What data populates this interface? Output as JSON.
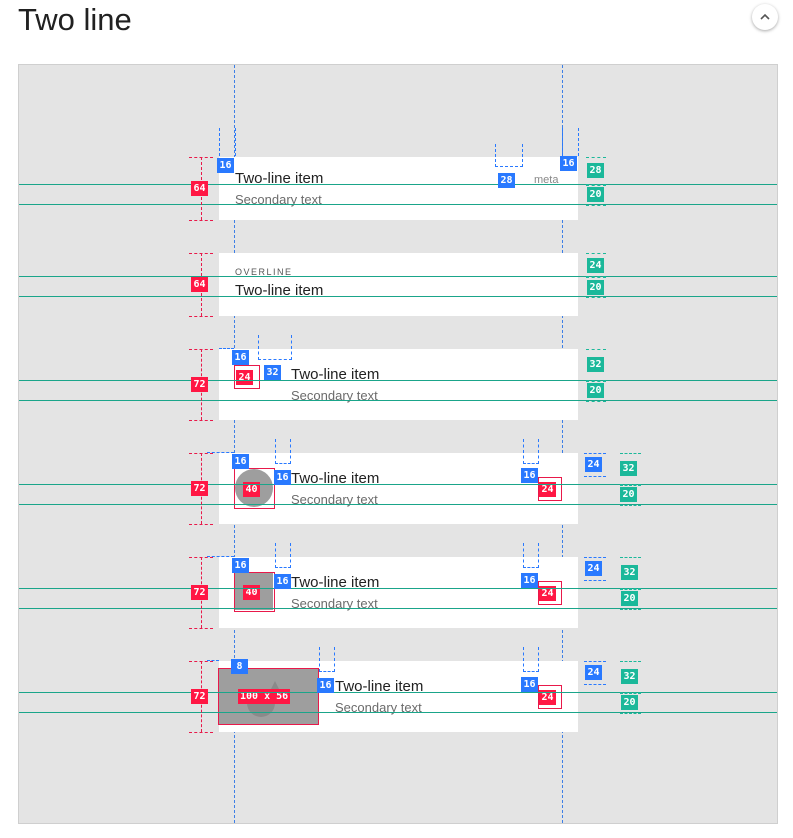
{
  "header": {
    "title": "Two line",
    "collapse_icon": "chevron-up-icon"
  },
  "colors": {
    "panel": "#e4e4e4",
    "keyline": "#1aa58a",
    "spacing": "#2979ff",
    "height": "#ff1744",
    "baseline": "#1bb89a"
  },
  "rows": [
    {
      "height": "64",
      "overline": "",
      "primary": "Two-line item",
      "secondary": "Secondary text",
      "meta": "meta",
      "leading": "",
      "trailing": "",
      "left_pad": "16",
      "text_gap": "",
      "trailing_gap": "",
      "right_pad": "16",
      "meta_gap": "28",
      "top_baseline": "28",
      "bottom_baseline": "20",
      "trailing_top": ""
    },
    {
      "height": "64",
      "overline": "OVERLINE",
      "primary": "Two-line item",
      "secondary": "",
      "meta": "",
      "leading": "",
      "trailing": "",
      "left_pad": "",
      "text_gap": "",
      "trailing_gap": "",
      "right_pad": "",
      "meta_gap": "",
      "top_baseline": "24",
      "bottom_baseline": "20",
      "trailing_top": ""
    },
    {
      "height": "72",
      "overline": "",
      "primary": "Two-line item",
      "secondary": "Secondary text",
      "meta": "",
      "leading": "24",
      "trailing": "",
      "left_pad": "16",
      "text_gap": "32",
      "trailing_gap": "",
      "right_pad": "",
      "meta_gap": "",
      "top_baseline": "32",
      "bottom_baseline": "20",
      "trailing_top": ""
    },
    {
      "height": "72",
      "overline": "",
      "primary": "Two-line item",
      "secondary": "Secondary text",
      "meta": "",
      "leading": "40",
      "trailing": "24",
      "left_pad": "16",
      "text_gap": "16",
      "trailing_gap": "16",
      "right_pad": "",
      "meta_gap": "",
      "top_baseline": "32",
      "bottom_baseline": "20",
      "trailing_top": "24"
    },
    {
      "height": "72",
      "overline": "",
      "primary": "Two-line item",
      "secondary": "Secondary text",
      "meta": "",
      "leading": "40",
      "trailing": "24",
      "left_pad": "16",
      "text_gap": "16",
      "trailing_gap": "16",
      "right_pad": "",
      "meta_gap": "",
      "top_baseline": "32",
      "bottom_baseline": "20",
      "trailing_top": "24"
    },
    {
      "height": "72",
      "overline": "",
      "primary": "Two-line item",
      "secondary": "Secondary text",
      "meta": "",
      "leading": "100 x 56",
      "trailing": "24",
      "left_pad": "8",
      "text_gap": "16",
      "trailing_gap": "16",
      "right_pad": "",
      "meta_gap": "",
      "top_baseline": "32",
      "bottom_baseline": "20",
      "trailing_top": "24"
    }
  ]
}
